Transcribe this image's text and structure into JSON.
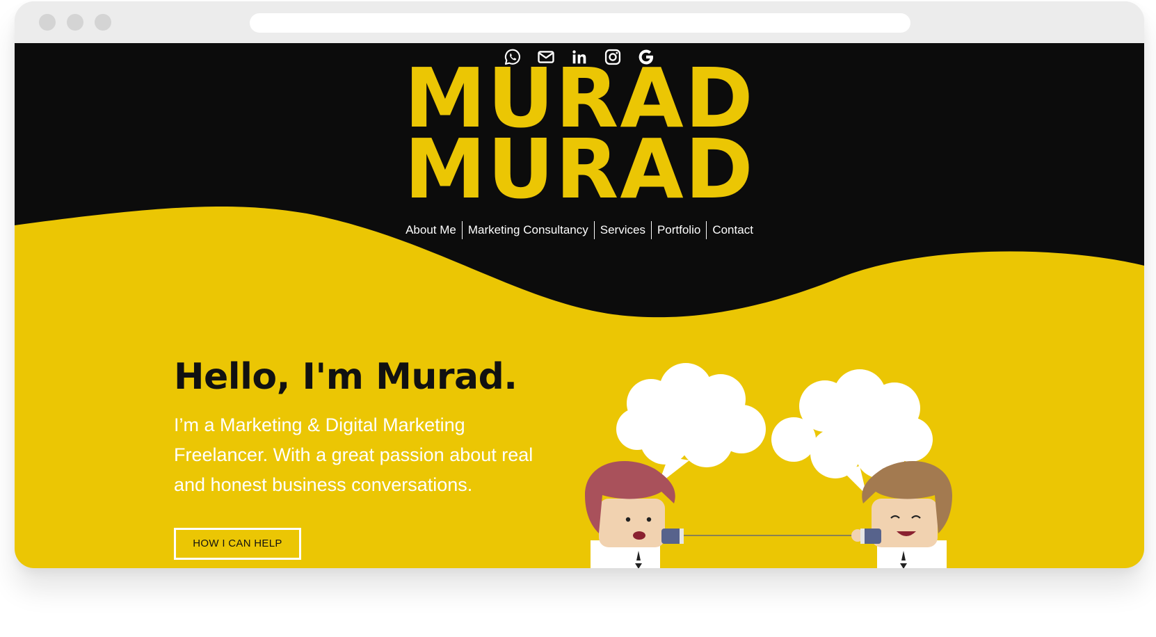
{
  "social": {
    "icons": [
      "whatsapp-icon",
      "envelope-icon",
      "linkedin-icon",
      "instagram-icon",
      "google-icon"
    ]
  },
  "logo": {
    "line1": "MURAD",
    "line2": "MURAD"
  },
  "nav": {
    "items": [
      "About Me",
      "Marketing Consultancy",
      "Services",
      "Portfolio",
      "Contact"
    ]
  },
  "hero": {
    "title": "Hello, I'm Murad.",
    "description": "I’m a Marketing & Digital Marketing Freelancer. With a great passion about real and honest business conversations.",
    "button_label": "HOW I CAN HELP"
  },
  "colors": {
    "accent": "#ebc604",
    "dark": "#0c0c0c",
    "text_light": "#ffffff"
  }
}
